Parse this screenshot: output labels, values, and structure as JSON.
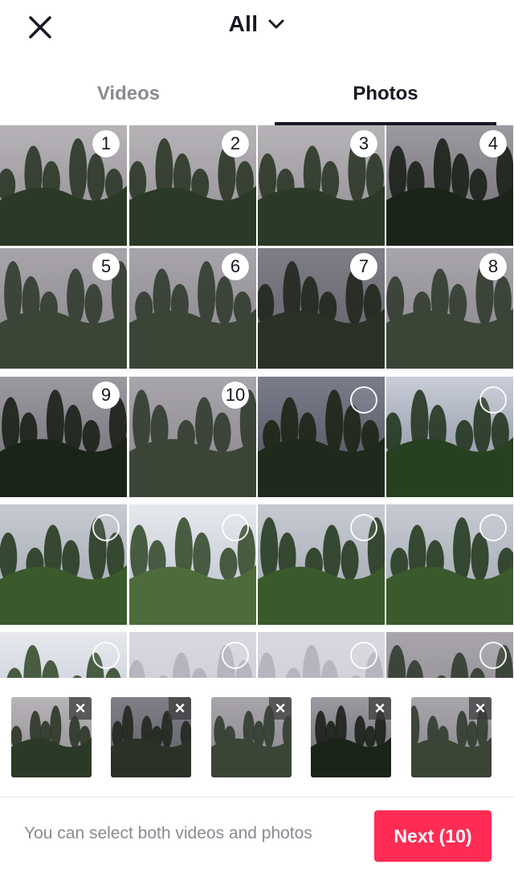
{
  "header": {
    "album": "All"
  },
  "tabs": {
    "videos": "Videos",
    "photos": "Photos",
    "active": "Photos"
  },
  "grid": {
    "tiles": [
      {
        "order": "1",
        "scene": "forest"
      },
      {
        "order": "2",
        "scene": "forest"
      },
      {
        "order": "3",
        "scene": "forest"
      },
      {
        "order": "4",
        "scene": "dark"
      },
      {
        "order": "5",
        "scene": "fog"
      },
      {
        "order": "6",
        "scene": "fog"
      },
      {
        "order": "7",
        "scene": "dusk"
      },
      {
        "order": "8",
        "scene": "fog"
      },
      {
        "order": "9",
        "scene": "dark"
      },
      {
        "order": "10",
        "scene": "fog"
      },
      {
        "order": "",
        "scene": "storm"
      },
      {
        "order": "",
        "scene": "sky"
      },
      {
        "order": "",
        "scene": "valley"
      },
      {
        "order": "",
        "scene": "cloud"
      },
      {
        "order": "",
        "scene": "valley"
      },
      {
        "order": "",
        "scene": "valley"
      },
      {
        "order": "",
        "scene": "cloud"
      },
      {
        "order": "",
        "scene": "pale"
      },
      {
        "order": "",
        "scene": "pale"
      },
      {
        "order": "",
        "scene": "fog"
      }
    ]
  },
  "tray": {
    "thumbs": [
      {
        "scene": "forest"
      },
      {
        "scene": "dusk"
      },
      {
        "scene": "fog"
      },
      {
        "scene": "dark"
      },
      {
        "scene": "fog"
      }
    ]
  },
  "footer": {
    "hint": "You can select both videos and photos",
    "next_label": "Next (10)"
  },
  "colors": {
    "accent": "#fe2c55",
    "text": "#161823",
    "muted": "#8a8b91"
  }
}
